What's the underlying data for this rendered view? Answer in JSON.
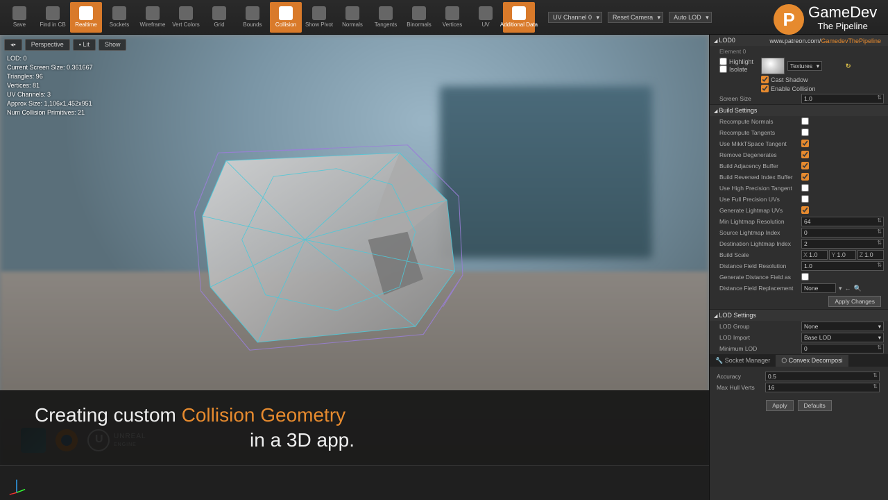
{
  "toolbar": {
    "buttons": [
      {
        "id": "save",
        "label": "Save",
        "active": false
      },
      {
        "id": "find",
        "label": "Find in CB",
        "active": false
      },
      {
        "id": "realtime",
        "label": "Realtime",
        "active": true
      },
      {
        "id": "sockets",
        "label": "Sockets",
        "active": false
      },
      {
        "id": "wireframe",
        "label": "Wireframe",
        "active": false
      },
      {
        "id": "vertcolors",
        "label": "Vert Colors",
        "active": false
      },
      {
        "id": "grid",
        "label": "Grid",
        "active": false
      },
      {
        "id": "bounds",
        "label": "Bounds",
        "active": false
      },
      {
        "id": "collision",
        "label": "Collision",
        "active": true
      },
      {
        "id": "showpivot",
        "label": "Show Pivot",
        "active": false
      },
      {
        "id": "normals",
        "label": "Normals",
        "active": false
      },
      {
        "id": "tangents",
        "label": "Tangents",
        "active": false
      },
      {
        "id": "binormals",
        "label": "Binormals",
        "active": false
      },
      {
        "id": "vertices",
        "label": "Vertices",
        "active": false
      },
      {
        "id": "uv",
        "label": "UV",
        "active": false
      },
      {
        "id": "additional",
        "label": "Additional Data",
        "active": true
      }
    ],
    "uv_channel": "UV Channel 0",
    "reset_camera": "Reset Camera",
    "auto_lod": "Auto LOD"
  },
  "viewport_buttons": {
    "perspective": "Perspective",
    "lit": "Lit",
    "show": "Show"
  },
  "stats": {
    "lod": "LOD: 0",
    "screen_size": "Current Screen Size: 0.361667",
    "triangles": "Triangles: 96",
    "vertices": "Vertices: 81",
    "uv_channels": "UV Channels: 3",
    "approx": "Approx Size: 1,106x1,452x951",
    "collision": "Num Collision Primitives: 21"
  },
  "brand": {
    "name": "GameDev",
    "sub": "The Pipeline",
    "url_prefix": "www.patreon.com/",
    "url_hl": "GamedevThePipeline"
  },
  "banner": {
    "pre": "Creating custom ",
    "hl": "Collision Geometry",
    "line2": "in a 3D app."
  },
  "ue_label": "UNREAL",
  "ue_label2": "ENGINE",
  "panel": {
    "lod0": "LOD0",
    "element": "Element 0",
    "highlight": "Highlight",
    "isolate": "Isolate",
    "textures": "Textures",
    "cast_shadow": "Cast Shadow",
    "enable_collision": "Enable Collision",
    "screen_size": {
      "k": "Screen Size",
      "v": "1.0"
    },
    "build_settings": "Build Settings",
    "build": [
      {
        "k": "Recompute Normals",
        "v": false,
        "t": "cb"
      },
      {
        "k": "Recompute Tangents",
        "v": false,
        "t": "cb"
      },
      {
        "k": "Use MikkTSpace Tangent",
        "v": true,
        "t": "cb"
      },
      {
        "k": "Remove Degenerates",
        "v": true,
        "t": "cb"
      },
      {
        "k": "Build Adjacency Buffer",
        "v": true,
        "t": "cb"
      },
      {
        "k": "Build Reversed Index Buffer",
        "v": true,
        "t": "cb"
      },
      {
        "k": "Use High Precision Tangent",
        "v": false,
        "t": "cb"
      },
      {
        "k": "Use Full Precision UVs",
        "v": false,
        "t": "cb"
      },
      {
        "k": "Generate Lightmap UVs",
        "v": true,
        "t": "cb"
      },
      {
        "k": "Min Lightmap Resolution",
        "v": "64",
        "t": "num"
      },
      {
        "k": "Source Lightmap Index",
        "v": "0",
        "t": "num"
      },
      {
        "k": "Destination Lightmap Index",
        "v": "2",
        "t": "num"
      },
      {
        "k": "Build Scale",
        "v": {
          "x": "1.0",
          "y": "1.0",
          "z": "1.0"
        },
        "t": "xyz"
      },
      {
        "k": "Distance Field Resolution",
        "v": "1.0",
        "t": "num"
      },
      {
        "k": "Generate Distance Field as",
        "v": false,
        "t": "cb"
      },
      {
        "k": "Distance Field Replacement",
        "v": "None",
        "t": "asset"
      }
    ],
    "apply_changes": "Apply Changes",
    "lod_settings": "LOD Settings",
    "lod_group": {
      "k": "LOD Group",
      "v": "None"
    },
    "lod_import": {
      "k": "LOD Import",
      "v": "Base LOD"
    },
    "min_lod": {
      "k": "Minimum LOD",
      "v": "0"
    },
    "tabs": {
      "socket": "Socket Manager",
      "convex": "Convex Decomposi"
    },
    "accuracy": {
      "k": "Accuracy",
      "v": "0.5"
    },
    "max_hull": {
      "k": "Max Hull Verts",
      "v": "16"
    },
    "apply": "Apply",
    "defaults": "Defaults"
  }
}
